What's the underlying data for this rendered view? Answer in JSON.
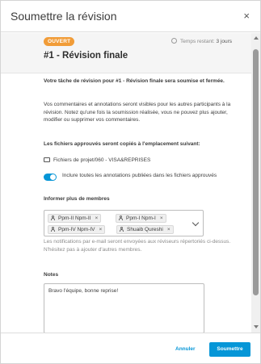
{
  "dialog": {
    "title": "Soumettre la révision",
    "close_symbol": "×"
  },
  "review": {
    "status_badge": "OUVERT",
    "time_label": "Temps restant: ",
    "time_value": "3 jours",
    "title": "#1 - Révision finale"
  },
  "content": {
    "intro": "Votre tâche de révision pour #1 - Révision finale sera soumise et fermée.",
    "comments_info": "Vos commentaires et annotations seront visibles pour les autres participants à la révision. Notez qu'une fois la soumission réalisée, vous ne pouvez plus ajouter, modifier ou supprimer vos commentaires.",
    "copy_location_label": "Les fichiers approuvés seront copiés à l'emplacement suivant:",
    "folder_path": "Fichiers de projet/060 - VISA&REPRISES",
    "include_annotations_label": "Inclure toutes les annotations publiées dans les fichiers approuvés",
    "include_annotations_on": true,
    "members_label": "Informer plus de membres",
    "members": [
      {
        "name": "Ppm-II Npm-II"
      },
      {
        "name": "Ppm-I Npm-I"
      },
      {
        "name": "Ppm-IV Npm-IV"
      },
      {
        "name": "Shuaib Qureshi"
      }
    ],
    "chip_remove_symbol": "×",
    "notification_info": "Les notifications par e-mail seront envoyées aux réviseurs répertoriés ci-dessus. N'hésitez pas à ajouter d'autres membres.",
    "notes_label": "Notes",
    "notes_value": "Bravo l'équipe, bonne reprise!"
  },
  "footer": {
    "cancel_label": "Annuler",
    "submit_label": "Soumettre"
  },
  "colors": {
    "accent": "#0696d7",
    "badge": "#f19c38"
  }
}
